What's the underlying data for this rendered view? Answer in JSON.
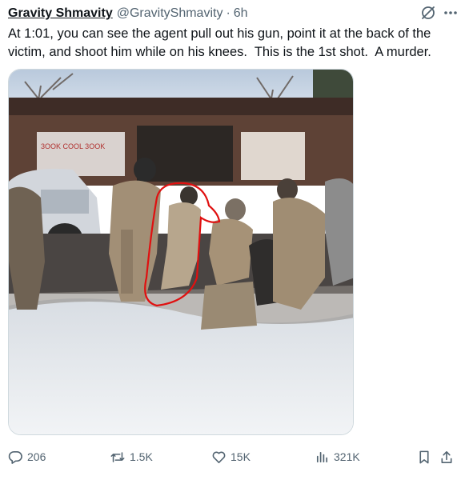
{
  "post": {
    "author_name": "Gravity Shmavity",
    "author_handle": "@GravityShmavity",
    "separator": "·",
    "time": "6h",
    "text": "At 1:01, you can see the agent pull out his gun, point it at the back of the victim, and shoot him while on his knees.  This is the 1st shot.  A murder."
  },
  "media": {
    "storefront_sign": "3OOK COOL 3OOK"
  },
  "actions": {
    "replies": "206",
    "reposts": "1.5K",
    "likes": "15K",
    "views": "321K"
  },
  "icons": {
    "grok": "grok-icon",
    "more": "more-dots-icon",
    "reply": "reply-icon",
    "repost": "repost-icon",
    "like": "heart-icon",
    "views": "views-bar-chart-icon",
    "bookmark": "bookmark-icon",
    "share": "share-icon"
  },
  "colors": {
    "text": "#0f1419",
    "secondary": "#536471",
    "annotation_circle": "#e01010"
  }
}
